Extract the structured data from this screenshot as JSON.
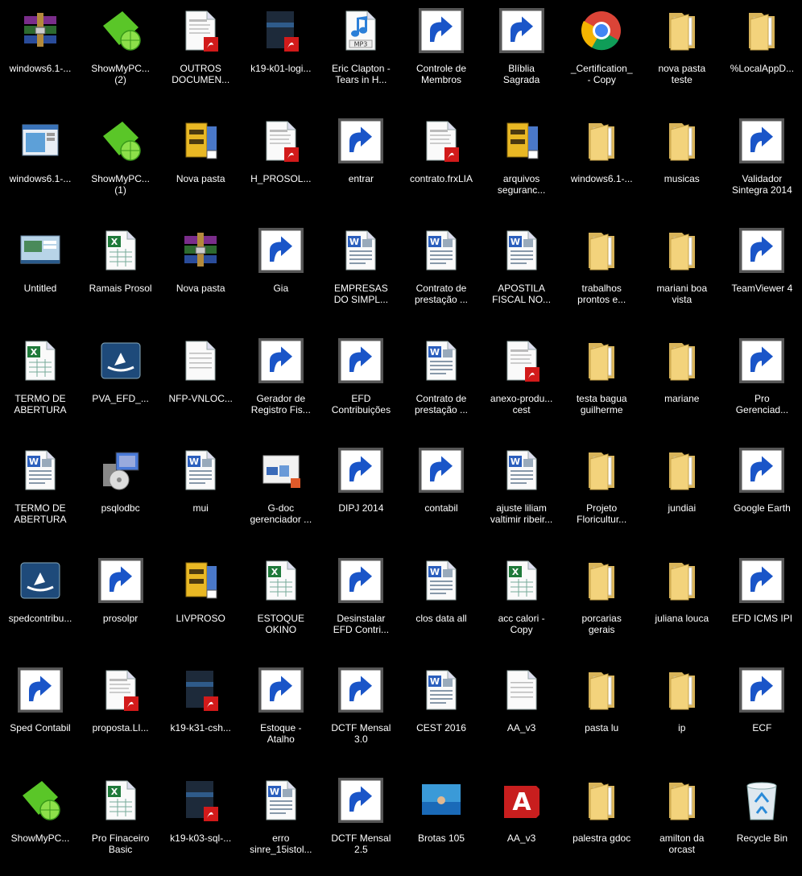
{
  "desktop": {
    "icons": [
      {
        "label": "windows6.1-...",
        "icon": "winrar-archive-icon",
        "shortcut": false
      },
      {
        "label": "ShowMyPC...\n(2)",
        "icon": "showmypc-icon",
        "shortcut": false
      },
      {
        "label": "OUTROS\nDOCUMEN...",
        "icon": "pdf-document-icon",
        "shortcut": false
      },
      {
        "label": "k19-k01-logi...",
        "icon": "pdf-book-icon",
        "shortcut": false
      },
      {
        "label": "Eric Clapton -\nTears in H...",
        "icon": "mp3-file-icon",
        "shortcut": false
      },
      {
        "label": "Controle de\nMembros",
        "icon": "users-app-icon",
        "shortcut": true
      },
      {
        "label": "Blíblia\nSagrada",
        "icon": "bible-app-icon",
        "shortcut": true
      },
      {
        "label": "_Certification_\n- Copy",
        "icon": "chrome-icon",
        "shortcut": false
      },
      {
        "label": "nova pasta\nteste",
        "icon": "folder-icon",
        "shortcut": false
      },
      {
        "label": "%LocalAppD...",
        "icon": "folder-icon",
        "shortcut": false
      },
      {
        "label": "windows6.1-...",
        "icon": "window-app-icon",
        "shortcut": false
      },
      {
        "label": "ShowMyPC...\n(1)",
        "icon": "showmypc-icon",
        "shortcut": false
      },
      {
        "label": "Nova pasta",
        "icon": "zip-archive-icon",
        "shortcut": false
      },
      {
        "label": "H_PROSOL...",
        "icon": "pdf-document-icon",
        "shortcut": false
      },
      {
        "label": "entrar",
        "icon": "open-folder-icon",
        "shortcut": true
      },
      {
        "label": "contrato.frxLIA",
        "icon": "pdf-document-icon",
        "shortcut": false
      },
      {
        "label": "arquivos\nseguranc...",
        "icon": "zip-archive-icon",
        "shortcut": false
      },
      {
        "label": "windows6.1-...",
        "icon": "folder-icon",
        "shortcut": false
      },
      {
        "label": "musicas",
        "icon": "folder-icon",
        "shortcut": false
      },
      {
        "label": "Validador\nSintegra 2014",
        "icon": "sintegra-icon",
        "shortcut": true
      },
      {
        "label": "Untitled",
        "icon": "screenshot-image-icon",
        "shortcut": false
      },
      {
        "label": "Ramais Prosol",
        "icon": "excel-document-icon",
        "shortcut": false
      },
      {
        "label": "Nova pasta",
        "icon": "winrar-archive-icon",
        "shortcut": false
      },
      {
        "label": "Gia",
        "icon": "gia-app-icon",
        "shortcut": true
      },
      {
        "label": "EMPRESAS\nDO SIMPL...",
        "icon": "word-document-icon",
        "shortcut": false
      },
      {
        "label": "Contrato de\nprestação ...",
        "icon": "word-document-icon",
        "shortcut": false
      },
      {
        "label": "APOSTILA\nFISCAL NO...",
        "icon": "word-document-icon",
        "shortcut": false
      },
      {
        "label": "trabalhos\nprontos e...",
        "icon": "folder-icon",
        "shortcut": false
      },
      {
        "label": "mariani boa\nvista",
        "icon": "folder-icon",
        "shortcut": false
      },
      {
        "label": "TeamViewer 4",
        "icon": "teamviewer-icon",
        "shortcut": true
      },
      {
        "label": "TERMO DE\nABERTURA",
        "icon": "excel-document-icon",
        "shortcut": false
      },
      {
        "label": "PVA_EFD_...",
        "icon": "sped-pva-icon",
        "shortcut": false
      },
      {
        "label": "NFP-VNLOC...",
        "icon": "text-file-icon",
        "shortcut": false
      },
      {
        "label": "Gerador de\nRegistro Fis...",
        "icon": "grf-app-icon",
        "shortcut": true
      },
      {
        "label": "EFD\nContribuições",
        "icon": "sped-globe-icon",
        "shortcut": true
      },
      {
        "label": "Contrato de\nprestação ...",
        "icon": "word-document-icon",
        "shortcut": false
      },
      {
        "label": "anexo-produ...\ncest",
        "icon": "pdf-document-icon",
        "shortcut": false
      },
      {
        "label": "testa bagua\nguilherme",
        "icon": "folder-icon",
        "shortcut": false
      },
      {
        "label": "mariane",
        "icon": "folder-icon",
        "shortcut": false
      },
      {
        "label": "Pro\nGerenciad...",
        "icon": "pro-gerenciador-icon",
        "shortcut": true
      },
      {
        "label": "TERMO DE\nABERTURA",
        "icon": "word-document-icon",
        "shortcut": false
      },
      {
        "label": "psqlodbc",
        "icon": "installer-icon",
        "shortcut": false
      },
      {
        "label": "mui",
        "icon": "word-document-icon",
        "shortcut": false
      },
      {
        "label": "G-doc\ngerenciador ...",
        "icon": "gdoc-icon",
        "shortcut": false
      },
      {
        "label": "DIPJ 2014",
        "icon": "receita-diamond-icon",
        "shortcut": true
      },
      {
        "label": "contabil",
        "icon": "contabil-app-icon",
        "shortcut": true
      },
      {
        "label": "ajuste liliam\nvaltimir ribeir...",
        "icon": "word-document-icon",
        "shortcut": false
      },
      {
        "label": "Projeto\nFloricultur...",
        "icon": "folder-icon",
        "shortcut": false
      },
      {
        "label": "jundiai",
        "icon": "folder-icon",
        "shortcut": false
      },
      {
        "label": "Google Earth",
        "icon": "google-earth-icon",
        "shortcut": true
      },
      {
        "label": "spedcontribu...",
        "icon": "sped-pva-icon",
        "shortcut": false
      },
      {
        "label": "prosolpr",
        "icon": "app-window-icon",
        "shortcut": true
      },
      {
        "label": "LIVPROSO",
        "icon": "zip-archive-icon",
        "shortcut": false
      },
      {
        "label": "ESTOQUE\nOKINO",
        "icon": "excel-document-icon",
        "shortcut": false
      },
      {
        "label": "Desinstalar\nEFD Contri...",
        "icon": "uninstall-icon",
        "shortcut": true
      },
      {
        "label": "clos data all",
        "icon": "word-document-icon",
        "shortcut": false
      },
      {
        "label": "acc calori -\nCopy",
        "icon": "excel-document-icon",
        "shortcut": false
      },
      {
        "label": "porcarias\ngerais",
        "icon": "folder-icon",
        "shortcut": false
      },
      {
        "label": "juliana louca",
        "icon": "folder-icon",
        "shortcut": false
      },
      {
        "label": "EFD ICMS IPI",
        "icon": "sped-globe-icon",
        "shortcut": true
      },
      {
        "label": "Sped Contabil",
        "icon": "sped-contabil-icon",
        "shortcut": true
      },
      {
        "label": "proposta.LI...",
        "icon": "pdf-document-icon",
        "shortcut": false
      },
      {
        "label": "k19-k31-csh...",
        "icon": "pdf-book-icon",
        "shortcut": false
      },
      {
        "label": "Estoque -\nAtalho",
        "icon": "window-app-icon",
        "shortcut": true
      },
      {
        "label": "DCTF Mensal\n3.0",
        "icon": "receita-diamond-icon",
        "shortcut": true
      },
      {
        "label": "CEST 2016",
        "icon": "word-document-icon",
        "shortcut": false
      },
      {
        "label": "AA_v3",
        "icon": "text-file-icon",
        "shortcut": false
      },
      {
        "label": "pasta lu",
        "icon": "folder-icon",
        "shortcut": false
      },
      {
        "label": "ip",
        "icon": "folder-icon",
        "shortcut": false
      },
      {
        "label": "ECF",
        "icon": "sped-globe-icon",
        "shortcut": true
      },
      {
        "label": "ShowMyPC...",
        "icon": "showmypc-icon",
        "shortcut": false
      },
      {
        "label": "Pro Finaceiro\nBasic",
        "icon": "excel-document-icon",
        "shortcut": false
      },
      {
        "label": "k19-k03-sql-...",
        "icon": "pdf-book-icon",
        "shortcut": false
      },
      {
        "label": "erro\nsinre_15istol...",
        "icon": "word-document-icon",
        "shortcut": false
      },
      {
        "label": "DCTF Mensal\n2.5",
        "icon": "receita-diamond-icon",
        "shortcut": true
      },
      {
        "label": "Brotas 105",
        "icon": "photo-image-icon",
        "shortcut": false
      },
      {
        "label": "AA_v3",
        "icon": "access-app-icon",
        "shortcut": false
      },
      {
        "label": "palestra gdoc",
        "icon": "folder-icon",
        "shortcut": false
      },
      {
        "label": "amilton da\norcast",
        "icon": "folder-icon",
        "shortcut": false
      },
      {
        "label": "Recycle Bin",
        "icon": "recycle-bin-icon",
        "shortcut": false
      }
    ]
  }
}
